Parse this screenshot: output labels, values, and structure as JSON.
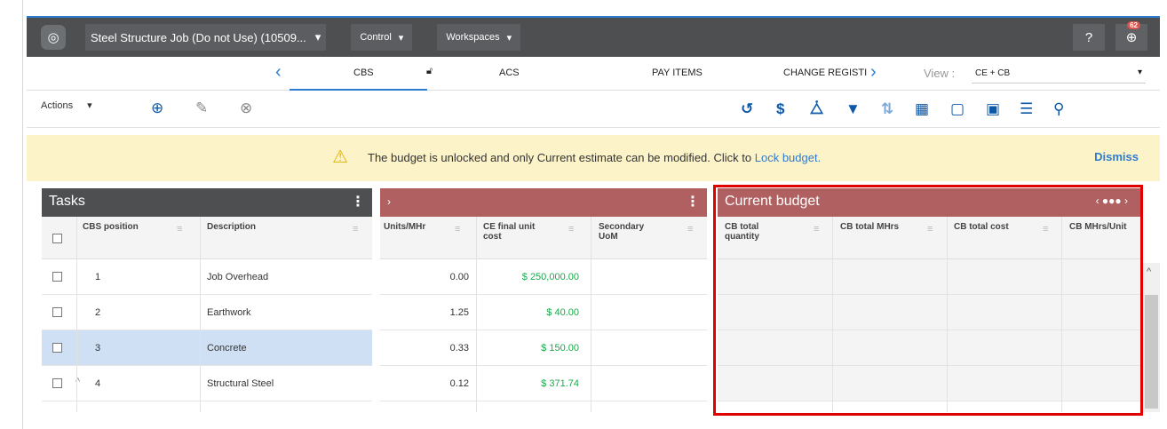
{
  "header": {
    "job_title": "Steel Structure Job (Do not Use) (10509...",
    "control_label": "Control",
    "workspaces_label": "Workspaces",
    "notification_count": "62",
    "help_glyph": "?"
  },
  "tabs": {
    "cbs": "CBS",
    "acs": "ACS",
    "pay_items": "PAY ITEMS",
    "change_register": "CHANGE REGISTI",
    "view_label": "View :",
    "view_value": "CE + CB"
  },
  "toolbar": {
    "actions_label": "Actions"
  },
  "banner": {
    "message": "The budget is unlocked and only Current estimate can be modified. Click to",
    "link": "Lock budget.",
    "dismiss": "Dismiss"
  },
  "tasks_panel": {
    "title": "Tasks",
    "col_position": "CBS position",
    "col_description": "Description"
  },
  "mid_panel": {
    "col_units": "Units/MHr",
    "col_ce_cost": "CE final unit cost",
    "col_secondary": "Secondary UoM"
  },
  "budget_panel": {
    "title": "Current budget",
    "col_qty": "CB total quantity",
    "col_mhrs": "CB total MHrs",
    "col_cost": "CB total cost",
    "col_mhrs_unit": "CB MHrs/Unit"
  },
  "rows": [
    {
      "position": "1",
      "description": "Job Overhead",
      "units": "0.00",
      "cost": "$ 250,000.00"
    },
    {
      "position": "2",
      "description": "Earthwork",
      "units": "1.25",
      "cost": "$ 40.00"
    },
    {
      "position": "3",
      "description": "Concrete",
      "units": "0.33",
      "cost": "$ 150.00"
    },
    {
      "position": "4",
      "description": "Structural Steel",
      "units": "0.12",
      "cost": "$ 371.74"
    }
  ],
  "colors": {
    "topbar": "#4d4f51",
    "accent": "#2e7cd0",
    "tasks_header": "#4d4f51",
    "budget_header": "#b06060",
    "selected_row": "#cfe0f4",
    "cost_green": "#1aa84c",
    "highlight_red": "#e10000"
  }
}
